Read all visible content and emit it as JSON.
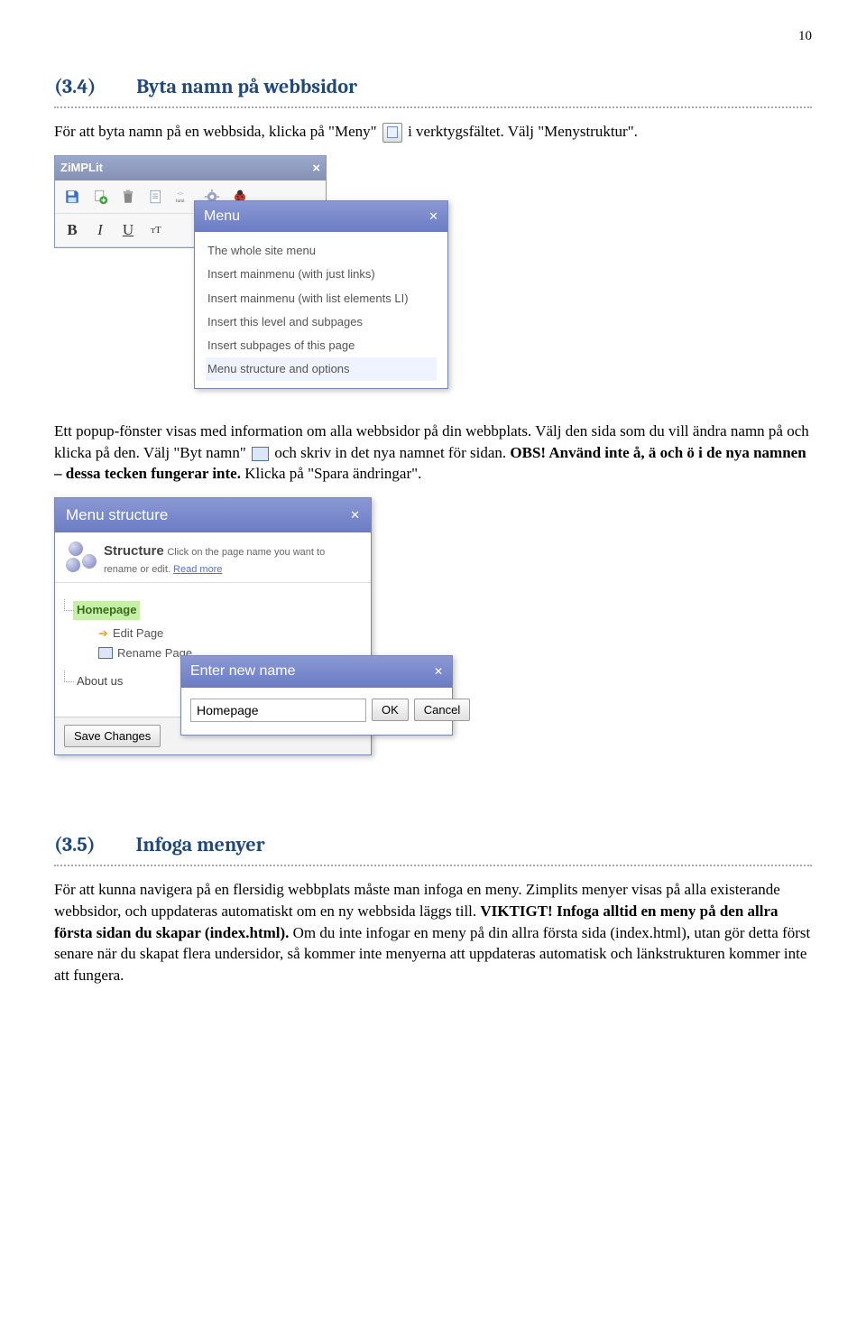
{
  "page_number": "10",
  "section34": {
    "number": "(3.4)",
    "title": "Byta namn på webbsidor",
    "para1a": "För att byta namn på en webbsida, klicka på \"Meny\" ",
    "para1b": " i verktygsfältet. Välj \"Menystruktur\".",
    "para2a": "Ett popup-fönster visas med information om alla webbsidor på din webbplats. Välj den sida som du vill ändra namn på och klicka på den. Välj \"Byt namn\" ",
    "para2b": " och skriv in det nya namnet för sidan. ",
    "para2_bold": "OBS! Använd inte å, ä och ö i de nya namnen – dessa tecken fungerar inte.",
    "para2c": " Klicka på \"Spara ändringar\"."
  },
  "zimplit": {
    "title": "ZiMPLit",
    "menu_title": "Menu",
    "items": [
      "The whole site menu",
      "Insert mainmenu (with just links)",
      "Insert mainmenu (with list elements LI)",
      "Insert this level and subpages",
      "Insert subpages of this page",
      "Menu structure and options"
    ]
  },
  "menustruct": {
    "title": "Menu structure",
    "struct_title": "Structure",
    "struct_sub": "Click on the page name you want to rename or edit. ",
    "read_more": "Read more",
    "node_homepage": "Homepage",
    "edit_page": "Edit Page",
    "rename_page": "Rename Page",
    "node_about": "About us",
    "save_changes": "Save Changes"
  },
  "entername": {
    "title": "Enter new name",
    "value": "Homepage",
    "ok": "OK",
    "cancel": "Cancel"
  },
  "section35": {
    "number": "(3.5)",
    "title": "Infoga menyer",
    "para_a": "För att kunna navigera på en flersidig webbplats måste man infoga en meny. Zimplits menyer visas på alla existerande webbsidor, och uppdateras automatiskt om en ny webbsida läggs till. ",
    "para_bold": "VIKTIGT! Infoga alltid en meny på den allra första sidan du skapar (index.html).",
    "para_b": " Om du inte infogar en meny på din allra första sida (index.html), utan gör detta först senare när du skapat flera undersidor, så kommer inte menyerna att uppdateras automatisk och länkstrukturen kommer inte att fungera."
  }
}
